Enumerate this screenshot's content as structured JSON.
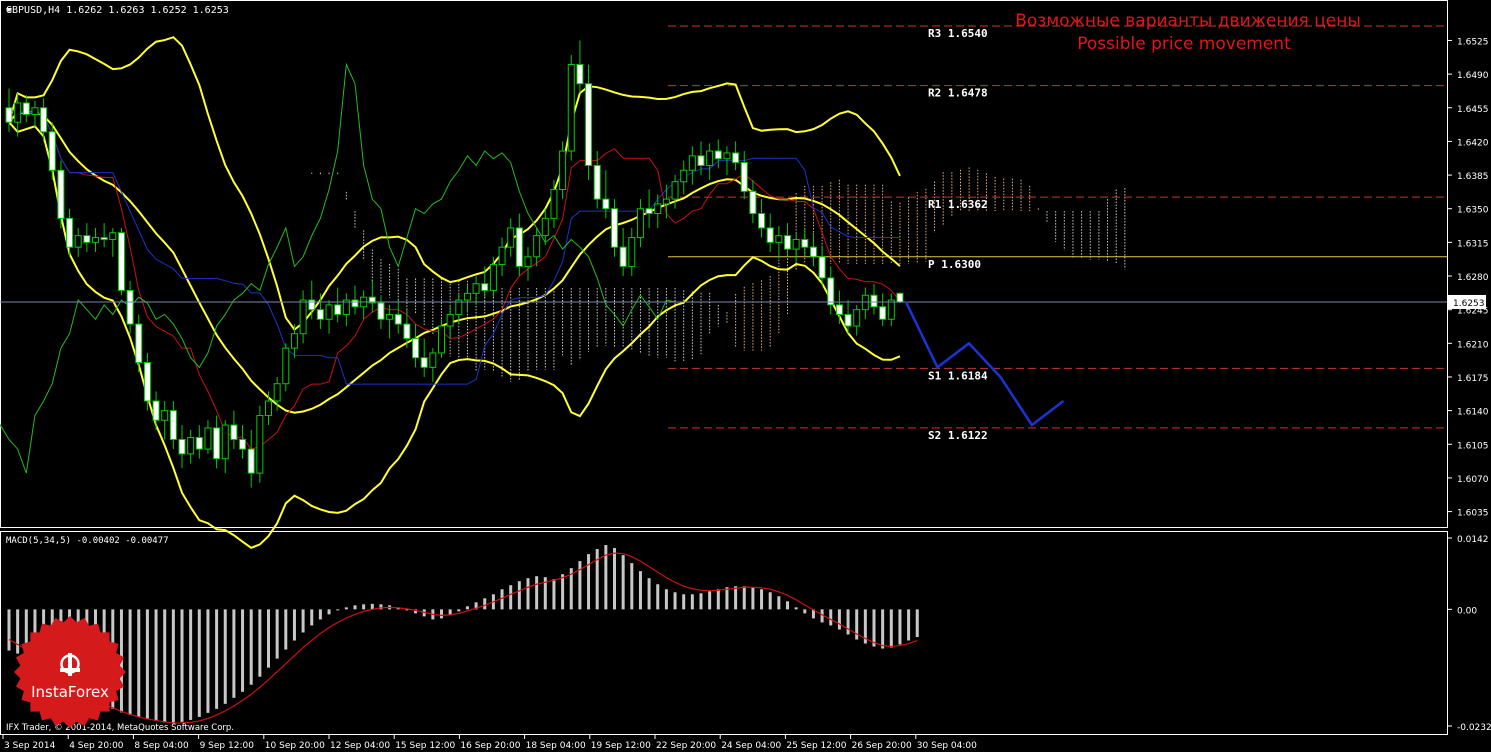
{
  "chart_data": [
    {
      "type": "candlestick",
      "symbol_header": "GBPUSD,H4  1.6262 1.6263 1.6252 1.6253",
      "title_ru": "Возможные варианты движения цены",
      "title_en": "Possible price movement",
      "current_price_label": "1.6253",
      "current_price": 1.6253,
      "ylim": [
        1.602,
        1.6565
      ],
      "y_ticks": [
        "1.6525",
        "1.6490",
        "1.6455",
        "1.6420",
        "1.6385",
        "1.6350",
        "1.6315",
        "1.6280",
        "1.6245",
        "1.6210",
        "1.6175",
        "1.6140",
        "1.6105",
        "1.6070",
        "1.6035"
      ],
      "pivot_levels": [
        {
          "label": "R3 1.6540",
          "value": 1.654,
          "color": "#c0392b"
        },
        {
          "label": "R2 1.6478",
          "value": 1.6478,
          "color": "#c0392b"
        },
        {
          "label": "R1 1.6362",
          "value": 1.6362,
          "color": "#c0392b"
        },
        {
          "label": "P  1.6300",
          "value": 1.63,
          "color": "#e5c44a"
        },
        {
          "label": "S1 1.6184",
          "value": 1.6184,
          "color": "#c0392b"
        },
        {
          "label": "S2 1.6122",
          "value": 1.6122,
          "color": "#c0392b"
        }
      ],
      "forecast_path": [
        1.6253,
        1.6185,
        1.621,
        1.6175,
        1.6125,
        1.615
      ],
      "candles": [
        [
          1.6455,
          1.6475,
          1.643,
          1.644
        ],
        [
          1.644,
          1.647,
          1.6425,
          1.646
        ],
        [
          1.646,
          1.6468,
          1.644,
          1.6448
        ],
        [
          1.6448,
          1.6462,
          1.6435,
          1.6455
        ],
        [
          1.6455,
          1.6465,
          1.642,
          1.643
        ],
        [
          1.643,
          1.644,
          1.638,
          1.639
        ],
        [
          1.639,
          1.64,
          1.633,
          1.634
        ],
        [
          1.634,
          1.635,
          1.63,
          1.631
        ],
        [
          1.631,
          1.633,
          1.63,
          1.6322
        ],
        [
          1.6322,
          1.6335,
          1.6305,
          1.6315
        ],
        [
          1.6315,
          1.633,
          1.6305,
          1.632
        ],
        [
          1.632,
          1.6335,
          1.631,
          1.6318
        ],
        [
          1.6318,
          1.633,
          1.63,
          1.6325
        ],
        [
          1.6325,
          1.633,
          1.626,
          1.6265
        ],
        [
          1.6265,
          1.6275,
          1.622,
          1.623
        ],
        [
          1.623,
          1.624,
          1.618,
          1.619
        ],
        [
          1.619,
          1.62,
          1.614,
          1.615
        ],
        [
          1.615,
          1.616,
          1.612,
          1.613
        ],
        [
          1.613,
          1.615,
          1.611,
          1.614
        ],
        [
          1.614,
          1.615,
          1.61,
          1.611
        ],
        [
          1.611,
          1.6125,
          1.608,
          1.6095
        ],
        [
          1.6095,
          1.612,
          1.6085,
          1.6112
        ],
        [
          1.6112,
          1.6125,
          1.609,
          1.61
        ],
        [
          1.61,
          1.613,
          1.6095,
          1.6122
        ],
        [
          1.6122,
          1.6135,
          1.608,
          1.609
        ],
        [
          1.609,
          1.613,
          1.6075,
          1.6125
        ],
        [
          1.6125,
          1.614,
          1.61,
          1.611
        ],
        [
          1.611,
          1.6125,
          1.609,
          1.61
        ],
        [
          1.61,
          1.612,
          1.606,
          1.6075
        ],
        [
          1.6075,
          1.6145,
          1.6065,
          1.6135
        ],
        [
          1.6135,
          1.616,
          1.6125,
          1.615
        ],
        [
          1.615,
          1.6175,
          1.614,
          1.6168
        ],
        [
          1.6168,
          1.621,
          1.616,
          1.6205
        ],
        [
          1.6205,
          1.623,
          1.6195,
          1.622
        ],
        [
          1.622,
          1.6265,
          1.621,
          1.6255
        ],
        [
          1.6255,
          1.6275,
          1.6235,
          1.6245
        ],
        [
          1.6245,
          1.6262,
          1.6225,
          1.6235
        ],
        [
          1.6235,
          1.6255,
          1.622,
          1.625
        ],
        [
          1.625,
          1.6268,
          1.6232,
          1.624
        ],
        [
          1.624,
          1.6262,
          1.6228,
          1.6255
        ],
        [
          1.6255,
          1.627,
          1.624,
          1.6248
        ],
        [
          1.6248,
          1.6265,
          1.6235,
          1.6258
        ],
        [
          1.6258,
          1.6275,
          1.6242,
          1.6252
        ],
        [
          1.6252,
          1.626,
          1.6225,
          1.6235
        ],
        [
          1.6235,
          1.625,
          1.6215,
          1.624
        ],
        [
          1.624,
          1.6255,
          1.622,
          1.623
        ],
        [
          1.623,
          1.6245,
          1.6205,
          1.6215
        ],
        [
          1.6215,
          1.623,
          1.6185,
          1.6195
        ],
        [
          1.6195,
          1.6215,
          1.6175,
          1.6185
        ],
        [
          1.6185,
          1.6205,
          1.617,
          1.62
        ],
        [
          1.62,
          1.6235,
          1.6195,
          1.6228
        ],
        [
          1.6228,
          1.625,
          1.6215,
          1.624
        ],
        [
          1.624,
          1.6262,
          1.623,
          1.6255
        ],
        [
          1.6255,
          1.627,
          1.6242,
          1.6262
        ],
        [
          1.6262,
          1.628,
          1.625,
          1.6272
        ],
        [
          1.6272,
          1.629,
          1.6258,
          1.6265
        ],
        [
          1.6265,
          1.63,
          1.6258,
          1.6292
        ],
        [
          1.6292,
          1.632,
          1.628,
          1.631
        ],
        [
          1.631,
          1.634,
          1.63,
          1.633
        ],
        [
          1.633,
          1.6345,
          1.628,
          1.629
        ],
        [
          1.629,
          1.631,
          1.6275,
          1.63
        ],
        [
          1.63,
          1.633,
          1.629,
          1.6322
        ],
        [
          1.6322,
          1.635,
          1.6312,
          1.634
        ],
        [
          1.634,
          1.638,
          1.633,
          1.637
        ],
        [
          1.637,
          1.642,
          1.636,
          1.641
        ],
        [
          1.641,
          1.651,
          1.64,
          1.65
        ],
        [
          1.65,
          1.6525,
          1.647,
          1.648
        ],
        [
          1.648,
          1.65,
          1.638,
          1.6395
        ],
        [
          1.6395,
          1.641,
          1.635,
          1.636
        ],
        [
          1.636,
          1.639,
          1.634,
          1.635
        ],
        [
          1.635,
          1.636,
          1.63,
          1.631
        ],
        [
          1.631,
          1.633,
          1.628,
          1.629
        ],
        [
          1.629,
          1.633,
          1.628,
          1.632
        ],
        [
          1.632,
          1.636,
          1.631,
          1.635
        ],
        [
          1.635,
          1.637,
          1.633,
          1.6345
        ],
        [
          1.6345,
          1.6365,
          1.633,
          1.6355
        ],
        [
          1.6355,
          1.6375,
          1.634,
          1.636
        ],
        [
          1.636,
          1.6385,
          1.635,
          1.6378
        ],
        [
          1.6378,
          1.64,
          1.6365,
          1.639
        ],
        [
          1.639,
          1.6415,
          1.6375,
          1.6405
        ],
        [
          1.6405,
          1.642,
          1.6385,
          1.6395
        ],
        [
          1.6395,
          1.6418,
          1.638,
          1.641
        ],
        [
          1.641,
          1.6422,
          1.6392,
          1.6402
        ],
        [
          1.6402,
          1.6415,
          1.6385,
          1.6408
        ],
        [
          1.6408,
          1.642,
          1.639,
          1.6398
        ],
        [
          1.6398,
          1.641,
          1.636,
          1.6368
        ],
        [
          1.6368,
          1.638,
          1.6335,
          1.6345
        ],
        [
          1.6345,
          1.636,
          1.632,
          1.633
        ],
        [
          1.633,
          1.6345,
          1.6305,
          1.6315
        ],
        [
          1.6315,
          1.6332,
          1.6298,
          1.6322
        ],
        [
          1.6322,
          1.6335,
          1.63,
          1.6308
        ],
        [
          1.6308,
          1.6325,
          1.6295,
          1.6318
        ],
        [
          1.6318,
          1.633,
          1.63,
          1.631
        ],
        [
          1.631,
          1.6325,
          1.629,
          1.63
        ],
        [
          1.63,
          1.6312,
          1.627,
          1.6278
        ],
        [
          1.6278,
          1.629,
          1.624,
          1.625
        ],
        [
          1.625,
          1.6265,
          1.623,
          1.624
        ],
        [
          1.624,
          1.6255,
          1.622,
          1.6228
        ],
        [
          1.6228,
          1.625,
          1.6218,
          1.6245
        ],
        [
          1.6245,
          1.6268,
          1.6235,
          1.626
        ],
        [
          1.626,
          1.6272,
          1.624,
          1.6248
        ],
        [
          1.6248,
          1.6262,
          1.6228,
          1.6235
        ],
        [
          1.6235,
          1.6262,
          1.6228,
          1.6255
        ],
        [
          1.6262,
          1.6263,
          1.6252,
          1.6253
        ]
      ],
      "x_tick_labels": [
        "3 Sep 2014",
        "4 Sep 20:00",
        "8 Sep 04:00",
        "9 Sep 12:00",
        "10 Sep 20:00",
        "12 Sep 04:00",
        "15 Sep 12:00",
        "16 Sep 20:00",
        "18 Sep 04:00",
        "19 Sep 12:00",
        "22 Sep 20:00",
        "24 Sep 04:00",
        "25 Sep 12:00",
        "26 Sep 20:00",
        "30 Sep 04:00"
      ],
      "colors": {
        "bull_fill": "#000000",
        "bear_fill": "#ffffff",
        "candle_stroke": "#00cc00",
        "yellow": "#ffff33",
        "red": "#cc1111",
        "blue": "#1b33cc",
        "green": "#22bb22",
        "forecast": "#1a35d6"
      }
    },
    {
      "type": "bar",
      "indicator_label": "MACD(5,34,5) -0.00402 -0.00477",
      "ylim": [
        -0.02321,
        0.0142
      ],
      "y_ticks": [
        "0.0142",
        "0.00",
        "-0.02321"
      ],
      "histogram": [
        -0.0082,
        -0.0088,
        -0.0094,
        -0.0102,
        -0.0112,
        -0.0124,
        -0.0138,
        -0.015,
        -0.016,
        -0.017,
        -0.018,
        -0.019,
        -0.0198,
        -0.0205,
        -0.021,
        -0.0214,
        -0.0218,
        -0.0222,
        -0.0225,
        -0.0226,
        -0.0224,
        -0.022,
        -0.0214,
        -0.0206,
        -0.0198,
        -0.0188,
        -0.0176,
        -0.0164,
        -0.015,
        -0.0134,
        -0.0116,
        -0.0098,
        -0.008,
        -0.0062,
        -0.0046,
        -0.0032,
        -0.002,
        -0.001,
        -0.0002,
        0.0004,
        0.0008,
        0.001,
        0.0011,
        0.001,
        0.0008,
        0.0004,
        -0.0002,
        -0.0008,
        -0.0014,
        -0.002,
        -0.0018,
        -0.0012,
        -0.0004,
        0.0006,
        0.0014,
        0.0022,
        0.003,
        0.004,
        0.0048,
        0.0056,
        0.0062,
        0.0066,
        0.0064,
        0.006,
        0.007,
        0.0082,
        0.0096,
        0.011,
        0.012,
        0.0128,
        0.0122,
        0.0108,
        0.0092,
        0.0076,
        0.0062,
        0.005,
        0.004,
        0.0034,
        0.003,
        0.003,
        0.0032,
        0.0036,
        0.004,
        0.0044,
        0.0046,
        0.0046,
        0.0044,
        0.004,
        0.0034,
        0.0026,
        0.0016,
        0.0004,
        -0.0008,
        -0.0018,
        -0.0026,
        -0.0032,
        -0.004,
        -0.005,
        -0.006,
        -0.0068,
        -0.0074,
        -0.0078,
        -0.0076,
        -0.007,
        -0.0062,
        -0.0055
      ],
      "signal_line": [
        -0.006,
        -0.007,
        -0.008,
        -0.0092,
        -0.0105,
        -0.0118,
        -0.0132,
        -0.0146,
        -0.0158,
        -0.0168,
        -0.0178,
        -0.0188,
        -0.0196,
        -0.0203,
        -0.0209,
        -0.0214,
        -0.0218,
        -0.0221,
        -0.0224,
        -0.0226,
        -0.0226,
        -0.0225,
        -0.0222,
        -0.0217,
        -0.021,
        -0.0202,
        -0.0192,
        -0.0181,
        -0.0169,
        -0.0155,
        -0.014,
        -0.0124,
        -0.0108,
        -0.0092,
        -0.0076,
        -0.0062,
        -0.0048,
        -0.0036,
        -0.0026,
        -0.0017,
        -0.001,
        -0.0004,
        0.0,
        0.0003,
        0.0004,
        0.0003,
        0.0001,
        -0.0002,
        -0.0006,
        -0.001,
        -0.0012,
        -0.0011,
        -0.0008,
        -0.0003,
        0.0002,
        0.0008,
        0.0015,
        0.0022,
        0.003,
        0.0037,
        0.0044,
        0.005,
        0.0054,
        0.0058,
        0.0063,
        0.007,
        0.0079,
        0.0089,
        0.0099,
        0.0108,
        0.0112,
        0.0111,
        0.0105,
        0.0096,
        0.0085,
        0.0074,
        0.0063,
        0.0054,
        0.0046,
        0.0041,
        0.0038,
        0.0037,
        0.0038,
        0.004,
        0.0042,
        0.0044,
        0.0044,
        0.0043,
        0.004,
        0.0035,
        0.0028,
        0.0019,
        0.0009,
        -0.0001,
        -0.0011,
        -0.002,
        -0.0029,
        -0.0039,
        -0.0049,
        -0.0058,
        -0.0066,
        -0.0072,
        -0.0074,
        -0.0072,
        -0.0068,
        -0.0062
      ],
      "colors": {
        "bars": "#c8c8c8",
        "line": "#cc1111"
      }
    }
  ],
  "logo": {
    "brand": "InstaForex",
    "color": "#d41a1a"
  },
  "footer": {
    "copyright": "IFX Trader, © 2001-2014, MetaQuotes Software Corp."
  },
  "colors": {
    "background": "#000000",
    "axis": "#ffffff",
    "grid": "#555555",
    "price_line": "#7788aa"
  }
}
